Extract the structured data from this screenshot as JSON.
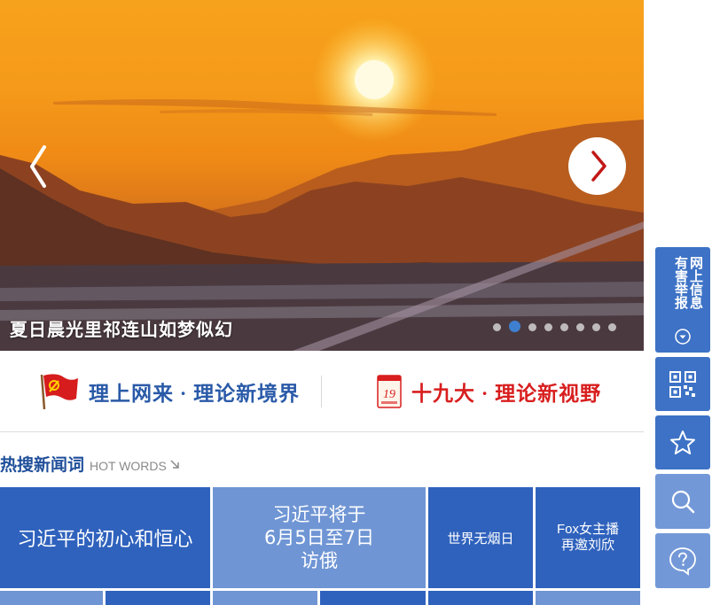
{
  "carousel": {
    "caption": "夏日晨光里祁连山如梦似幻",
    "slides_total": 8,
    "active_slide": 2
  },
  "banners": {
    "left_text": "理上网来 · 理论新境界",
    "right_text": "十九大 · 理论新视野",
    "right_emblem_number": "19"
  },
  "hot_words": {
    "title": "热搜新闻词",
    "subtitle": "HOT WORDS",
    "tiles": [
      {
        "text": "习近平的初心和恒心"
      },
      {
        "text": "习近平将于\n6月5日至7日\n访俄"
      },
      {
        "text": "世界无烟日"
      },
      {
        "text": "Fox女主播\n再邀刘欣"
      }
    ]
  },
  "sidebar": {
    "report_label": "网上信息有害举报",
    "items": [
      "qr-code",
      "favorite",
      "search",
      "help"
    ]
  },
  "colors": {
    "tile_dark": "#2f62bd",
    "tile_light": "#6f95d4",
    "sidebar_blue": "#3d72c6",
    "sidebar_light": "#7398d8",
    "banner_blue": "#2a5aa8",
    "banner_red": "#d81e1e"
  }
}
